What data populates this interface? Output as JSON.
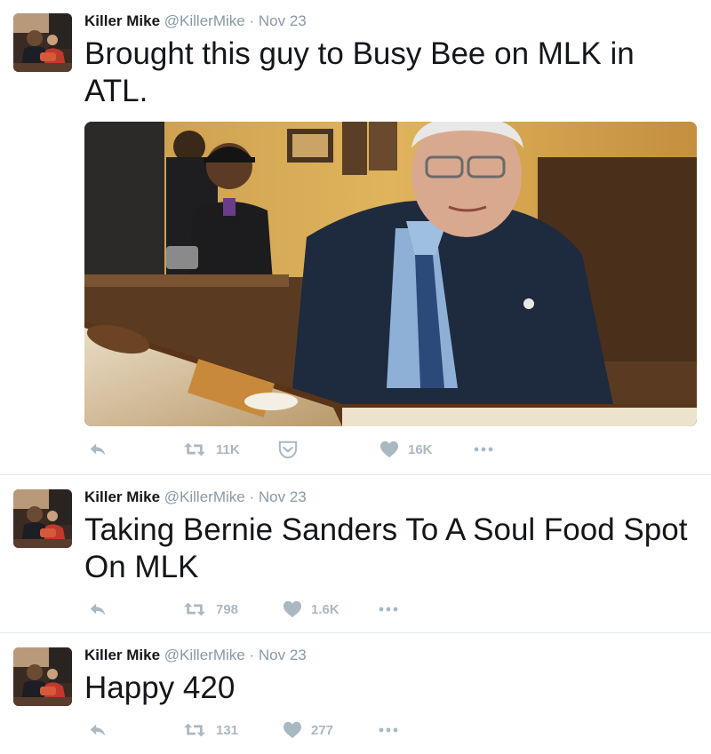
{
  "colors": {
    "text": "#14171a",
    "muted": "#8899a6",
    "icon": "#aab8c2",
    "divider": "#e1e8ed"
  },
  "tweets": [
    {
      "name": "Killer Mike",
      "handle": "@KillerMike",
      "separator": "·",
      "time": "Nov 23",
      "text": "Brought this guy to Busy Bee on MLK in ATL.",
      "has_media": true,
      "retweets": "11K",
      "likes": "16K"
    },
    {
      "name": "Killer Mike",
      "handle": "@KillerMike",
      "separator": "·",
      "time": "Nov 23",
      "text": "Taking Bernie Sanders To A Soul Food Spot On MLK",
      "retweets": "798",
      "likes": "1.6K"
    },
    {
      "name": "Killer Mike",
      "handle": "@KillerMike",
      "separator": "·",
      "time": "Nov 23",
      "text": "Happy 420",
      "retweets": "131",
      "likes": "277"
    }
  ],
  "icons": {
    "reply": "reply-icon",
    "retweet": "retweet-icon",
    "like": "heart-icon",
    "more": "more-dots-icon",
    "pocket": "pocket-icon"
  }
}
